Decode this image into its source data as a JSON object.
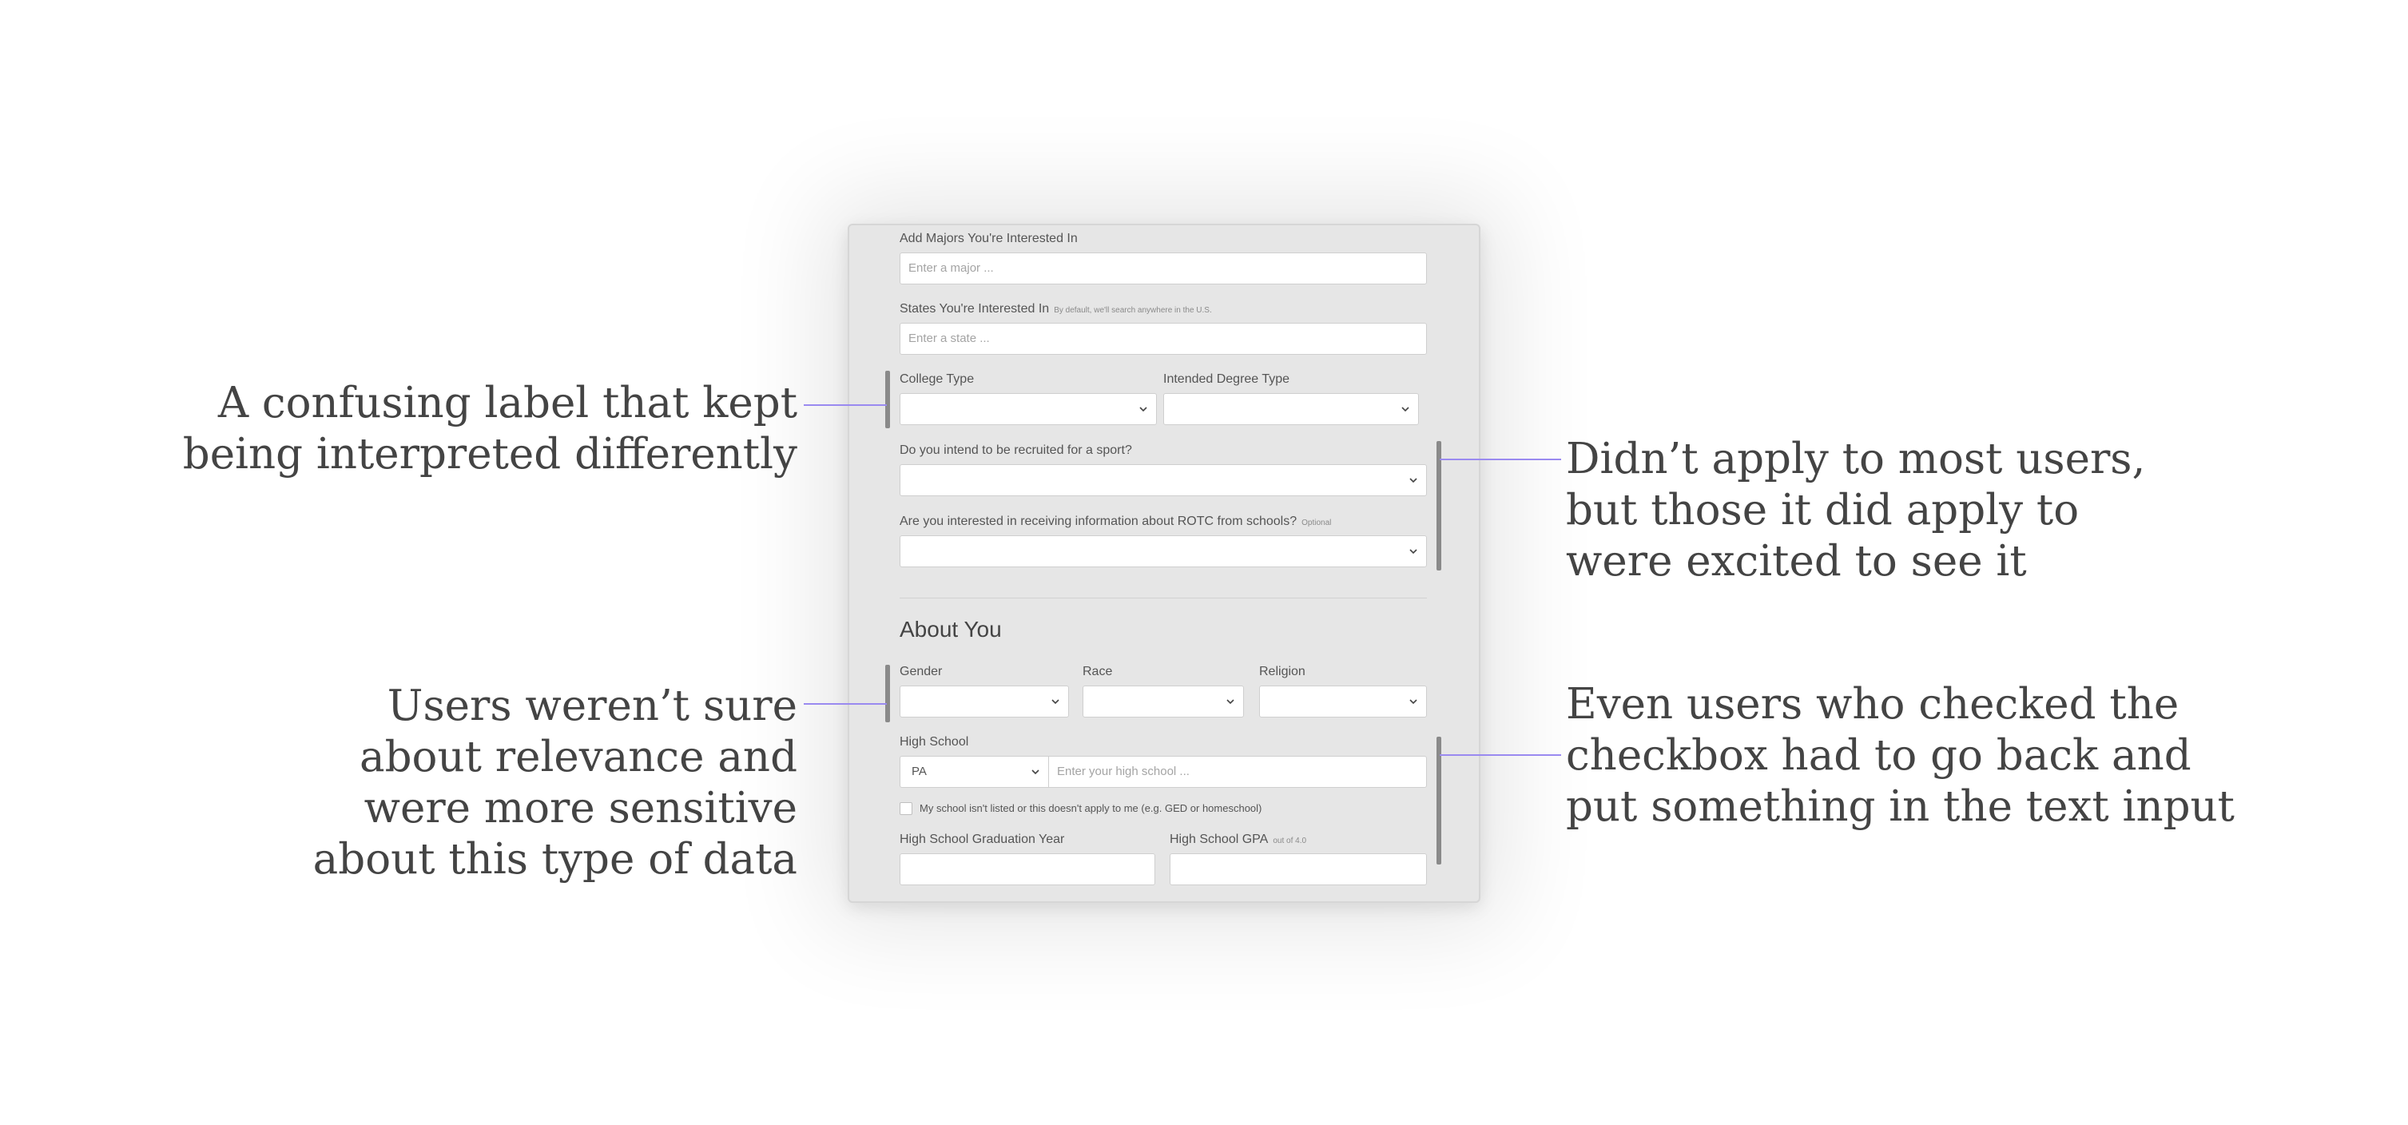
{
  "form": {
    "majors": {
      "label": "Add Majors You're Interested In",
      "placeholder": "Enter a major ..."
    },
    "states": {
      "label": "States You're Interested In",
      "hint": "By default, we'll search anywhere in the U.S.",
      "placeholder": "Enter a state ..."
    },
    "college_type": {
      "label": "College Type",
      "value": ""
    },
    "degree_type": {
      "label": "Intended Degree Type",
      "value": ""
    },
    "sport": {
      "label": "Do you intend to be recruited for a sport?",
      "value": ""
    },
    "rotc": {
      "label": "Are you interested in receiving information about ROTC from schools?",
      "hint": "Optional",
      "value": ""
    },
    "about_title": "About You",
    "gender": {
      "label": "Gender",
      "value": ""
    },
    "race": {
      "label": "Race",
      "value": ""
    },
    "religion": {
      "label": "Religion",
      "value": ""
    },
    "high_school": {
      "label": "High School",
      "state_value": "PA",
      "placeholder": "Enter your high school ..."
    },
    "school_not_listed": {
      "label": "My school isn't listed or this doesn't apply to me (e.g. GED or homeschool)",
      "checked": false
    },
    "grad_year": {
      "label": "High School Graduation Year",
      "value": ""
    },
    "gpa": {
      "label": "High School GPA",
      "hint": "out of 4.0",
      "value": ""
    }
  },
  "annotations": {
    "college_type_note": [
      "A confusing label that kept",
      "being interpreted differently"
    ],
    "sport_note": [
      "Didn’t apply to most users,",
      "but those it did apply to",
      "were excited to see it"
    ],
    "about_note": [
      "Users weren’t sure",
      "about relevance and",
      "were more sensitive",
      "about this type of data"
    ],
    "high_school_note": [
      "Even users who checked the",
      "checkbox had to go back and",
      "put something in the text input"
    ]
  },
  "colors": {
    "connector": "#9a8af0",
    "marker": "#8a8a8a",
    "card": "#e6e6e6"
  }
}
